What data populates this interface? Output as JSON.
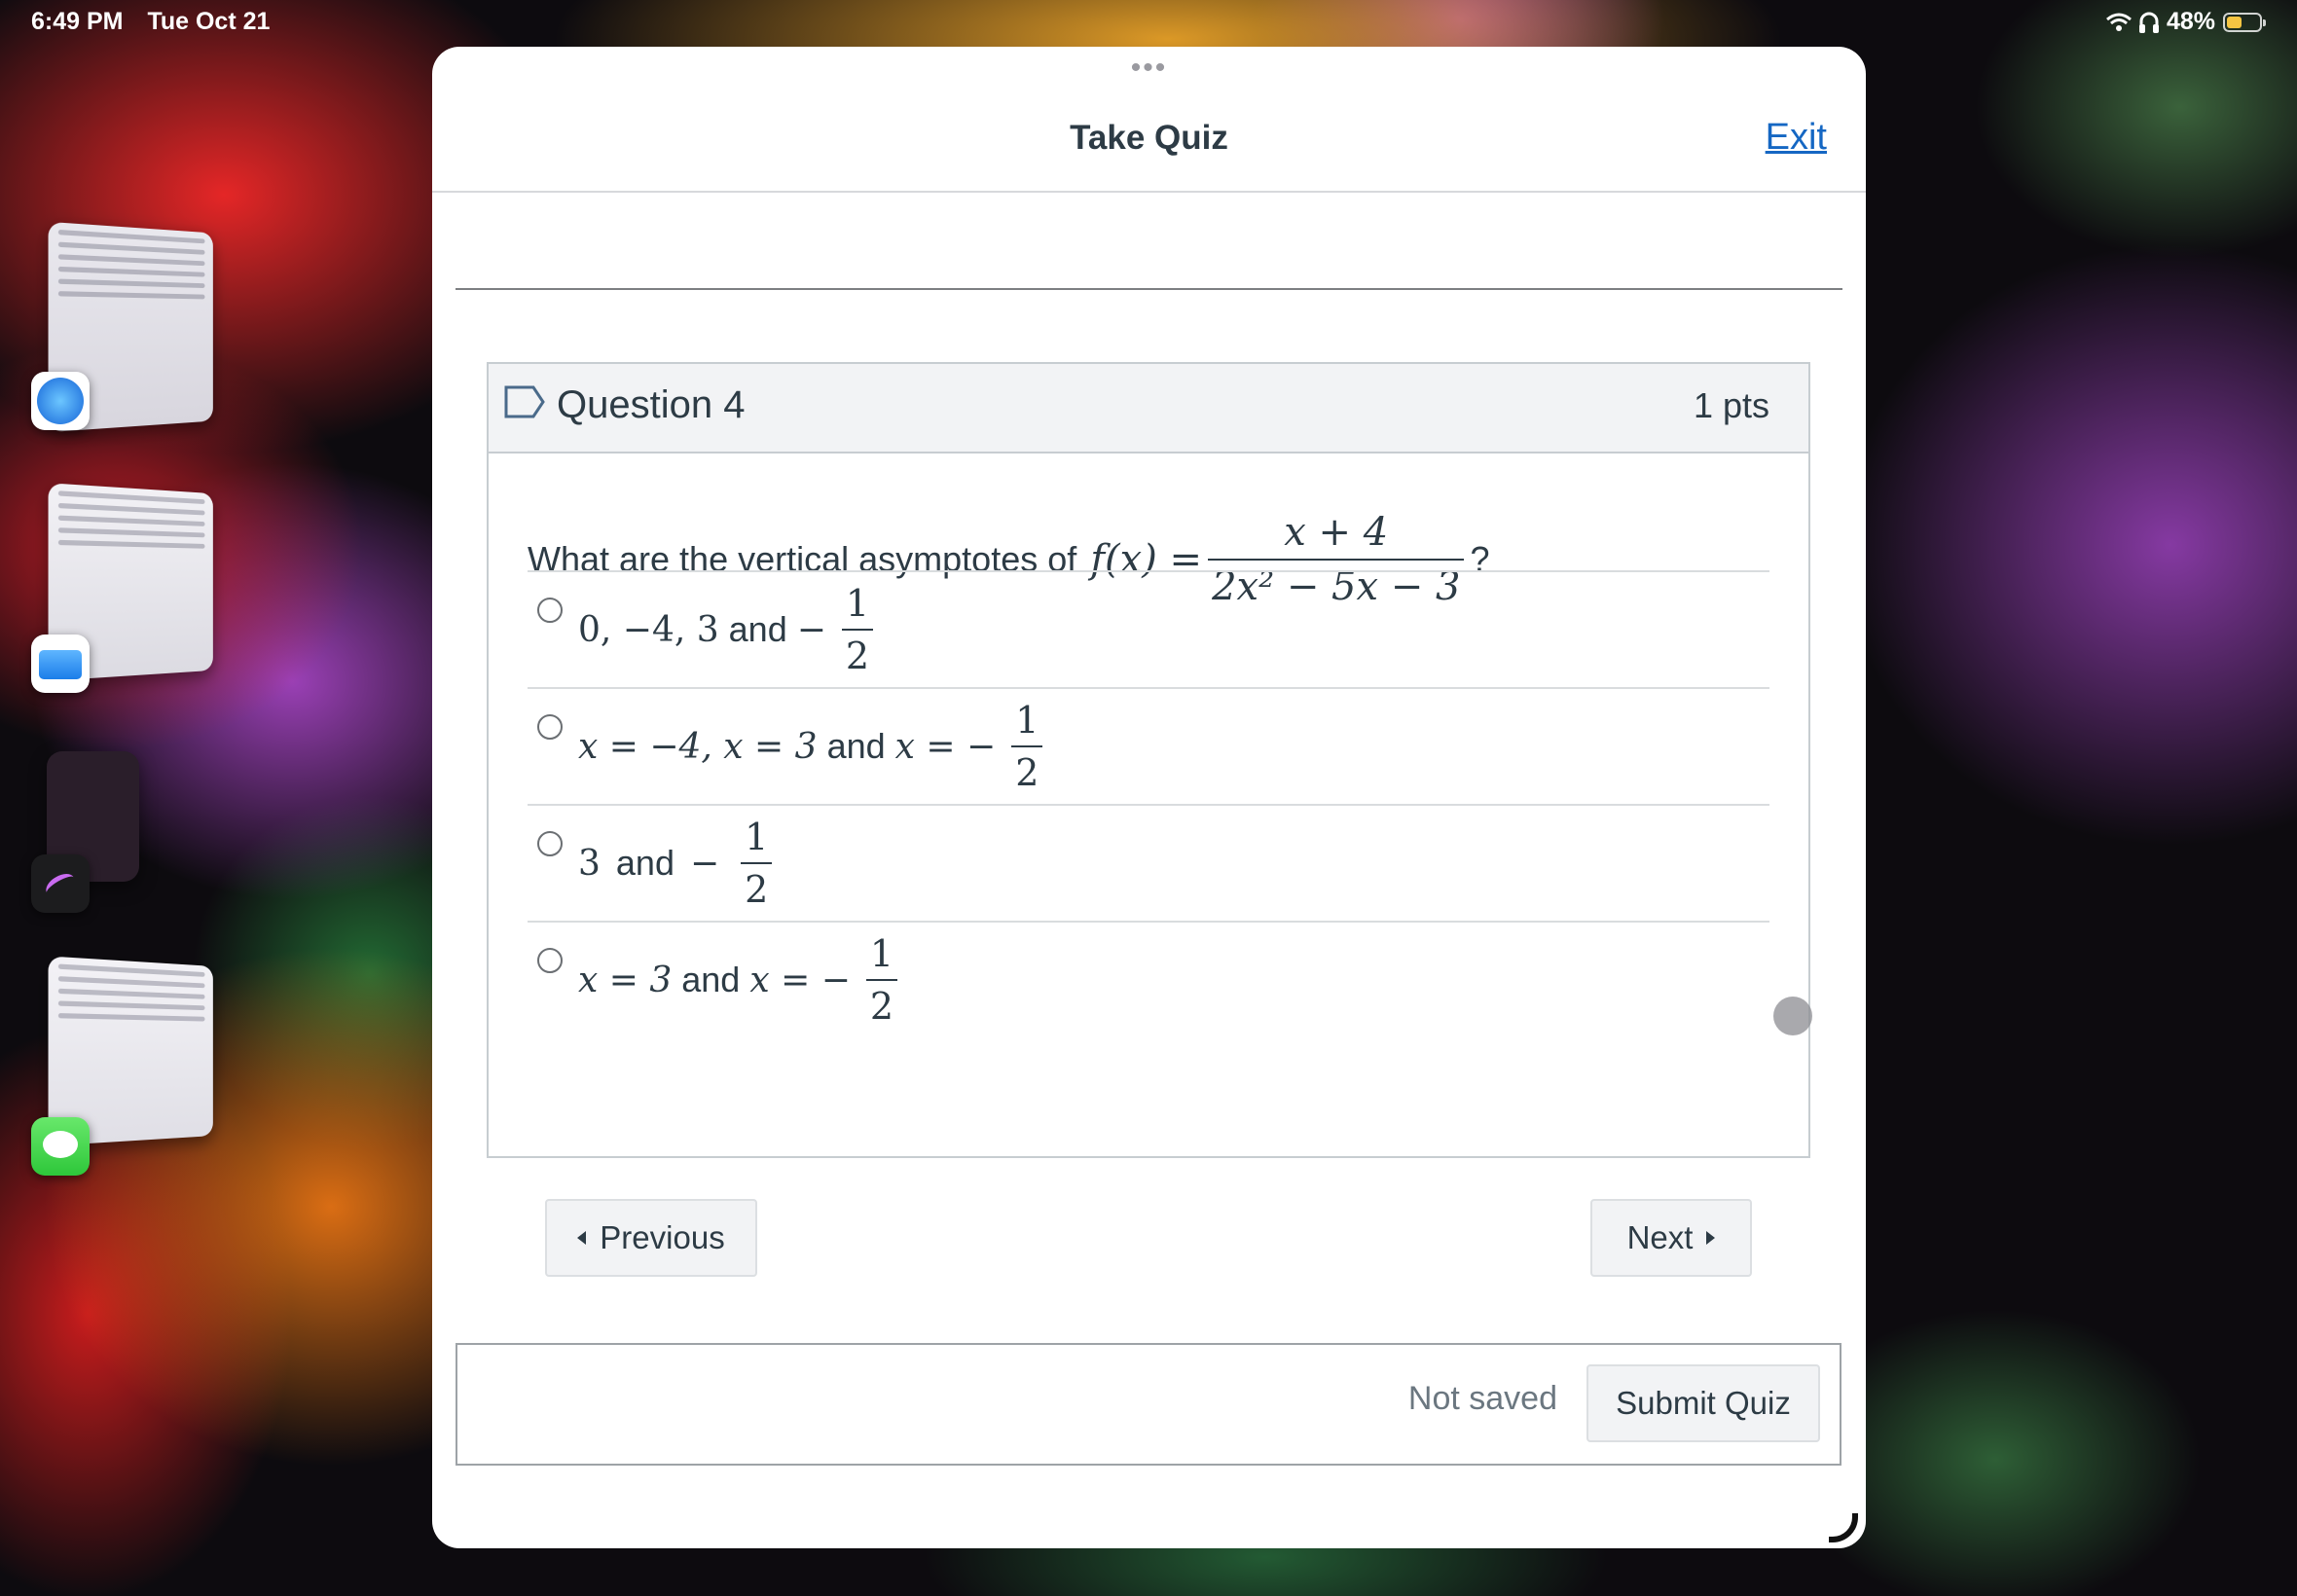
{
  "status_bar": {
    "time": "6:49 PM",
    "date": "Tue Oct 21",
    "battery": "48%",
    "battery_level": 0.48,
    "wifi_icon": "wifi-icon",
    "headphones_icon": "headphones-icon"
  },
  "window": {
    "title": "Take Quiz",
    "exit_label": "Exit"
  },
  "question": {
    "title": "Question 4",
    "points": "1 pts",
    "prompt_prefix": "What are the vertical asymptotes of",
    "function_lhs": "f(x) =",
    "fraction_numerator": "x + 4",
    "fraction_denominator": "2x² − 5x − 3",
    "prompt_suffix": "?"
  },
  "answers": [
    {
      "id": "a",
      "parts": [
        "0, −4, 3",
        "and",
        "−"
      ],
      "frac": {
        "num": "1",
        "den": "2"
      }
    },
    {
      "id": "b",
      "parts": [
        "x = −4, x = 3",
        "and",
        "x = −"
      ],
      "frac": {
        "num": "1",
        "den": "2"
      }
    },
    {
      "id": "c",
      "parts": [
        "3",
        "and",
        "−"
      ],
      "frac": {
        "num": "1",
        "den": "2"
      }
    },
    {
      "id": "d",
      "parts": [
        "x = 3",
        "and",
        "x = −"
      ],
      "frac": {
        "num": "1",
        "den": "2"
      }
    }
  ],
  "nav": {
    "previous_label": "Previous",
    "next_label": "Next"
  },
  "footer": {
    "save_status": "Not saved",
    "submit_label": "Submit Quiz"
  },
  "colors": {
    "link": "#1567c3",
    "text": "#2d3b45",
    "button_bg": "#f2f3f5"
  }
}
